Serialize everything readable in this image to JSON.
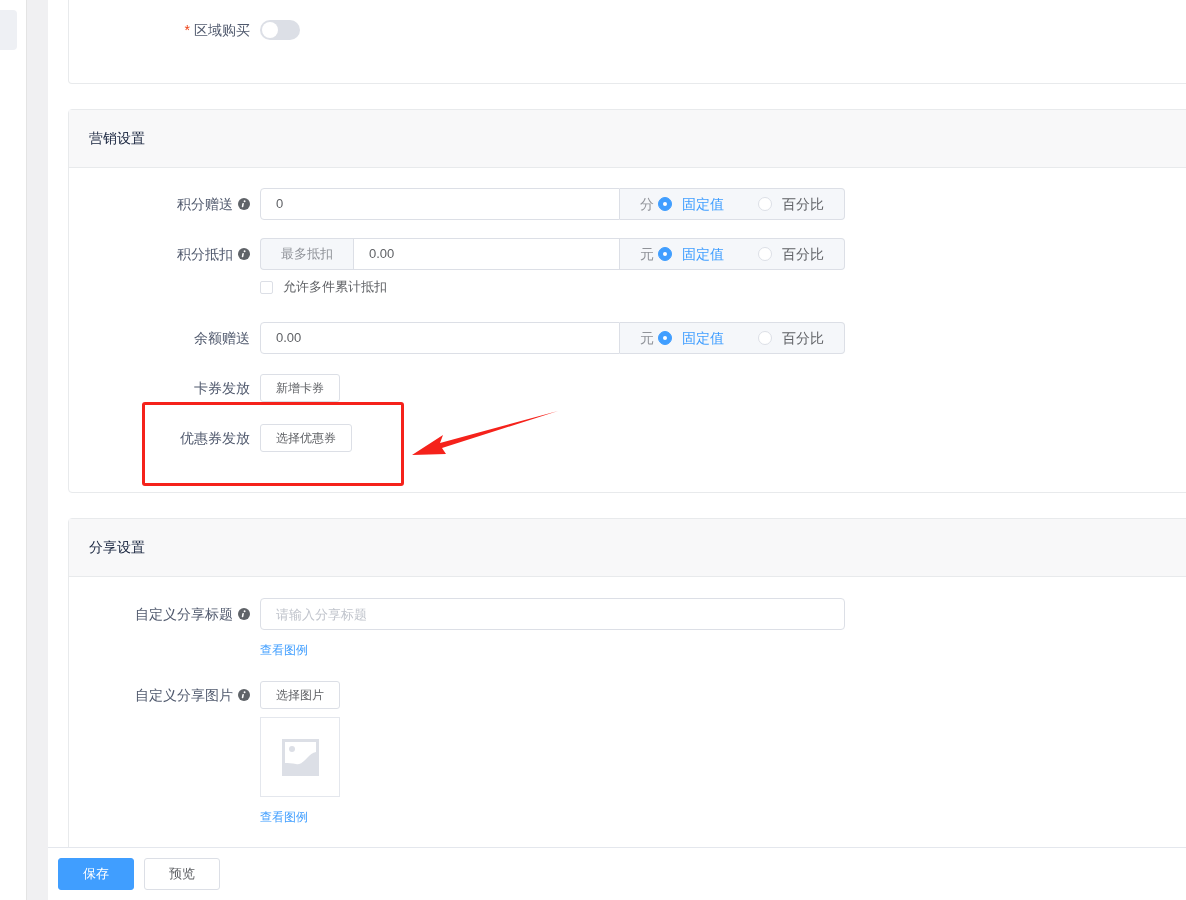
{
  "sections": [
    {
      "fields": [
        {
          "kind": "switch",
          "label": "区域购买",
          "required_mark": "*",
          "on": false
        }
      ]
    },
    {
      "title": "营销设置",
      "fields": [
        {
          "kind": "unit_input",
          "label": "积分赠送",
          "info": true,
          "value": "0",
          "unit": "分",
          "options": [
            {
              "label": "固定值",
              "selected": true
            },
            {
              "label": "百分比",
              "selected": false
            }
          ]
        },
        {
          "kind": "unit_input",
          "label": "积分抵扣",
          "info": true,
          "prefix": "最多抵扣",
          "value": "0.00",
          "unit": "元",
          "options": [
            {
              "label": "固定值",
              "selected": true
            },
            {
              "label": "百分比",
              "selected": false
            }
          ],
          "checkbox": {
            "label": "允许多件累计抵扣",
            "checked": false
          }
        },
        {
          "kind": "unit_input",
          "label": "余额赠送",
          "value": "0.00",
          "unit": "元",
          "options": [
            {
              "label": "固定值",
              "selected": true
            },
            {
              "label": "百分比",
              "selected": false
            }
          ]
        },
        {
          "kind": "button",
          "label": "卡券发放",
          "button": "新增卡券"
        },
        {
          "kind": "button",
          "label": "优惠券发放",
          "button": "选择优惠券",
          "highlighted": true
        }
      ]
    },
    {
      "title": "分享设置",
      "fields": [
        {
          "kind": "text_input",
          "label": "自定义分享标题",
          "info": true,
          "placeholder": "请输入分享标题",
          "link": "查看图例"
        },
        {
          "kind": "image_picker",
          "label": "自定义分享图片",
          "info": true,
          "button": "选择图片",
          "link": "查看图例"
        }
      ]
    }
  ],
  "footer": {
    "buttons": [
      {
        "label": "保存",
        "kind": "primary"
      },
      {
        "label": "预览",
        "kind": "default"
      }
    ]
  }
}
